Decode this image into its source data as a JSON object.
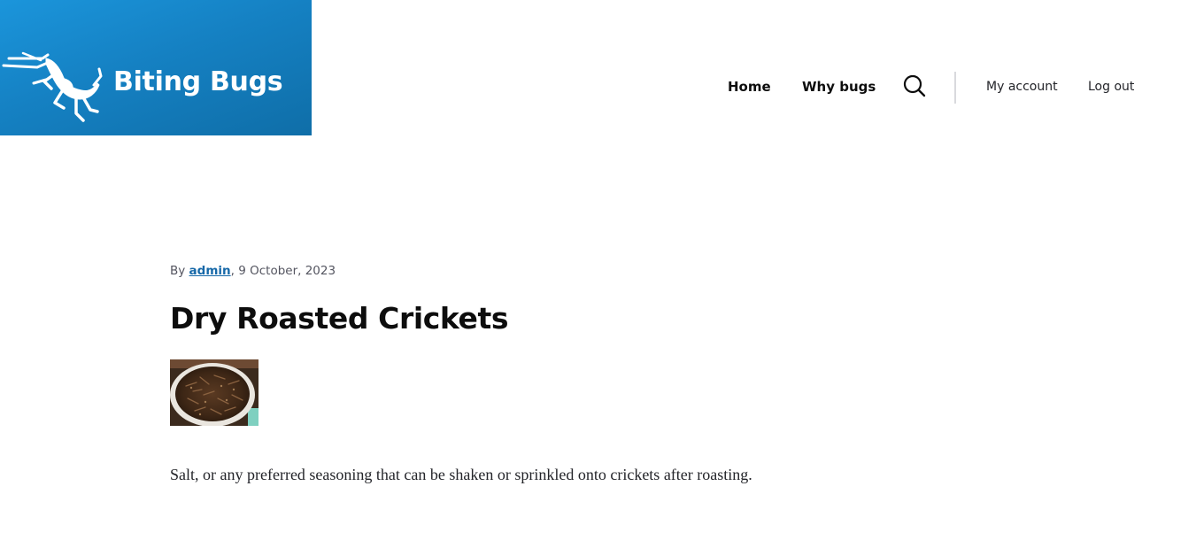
{
  "site": {
    "name": "Biting Bugs",
    "brand_gradient": [
      "#1b95db",
      "#0f6ea8"
    ]
  },
  "nav": {
    "primary": [
      {
        "label": "Home"
      },
      {
        "label": "Why bugs"
      }
    ],
    "search_icon": "search-icon",
    "secondary": [
      {
        "label": "My account"
      },
      {
        "label": "Log out"
      }
    ]
  },
  "article": {
    "meta_prefix": "By ",
    "author": "admin",
    "date": ", 9 October, 2023",
    "title": "Dry Roasted Crickets",
    "image_subject": "plate of roasted crickets",
    "body": "Salt, or any preferred seasoning that can be shaken or sprinkled onto crickets after roasting."
  },
  "colors": {
    "accent_link": "#1668a8",
    "text": "#232429"
  }
}
